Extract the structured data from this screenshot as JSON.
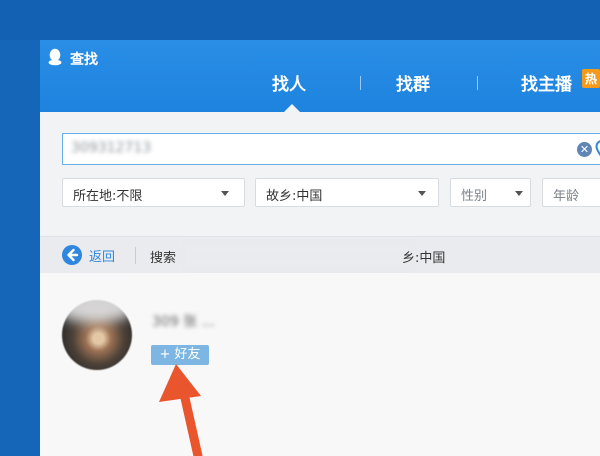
{
  "window": {
    "title": "查找"
  },
  "tabs": [
    {
      "label": "找人",
      "active": true
    },
    {
      "label": "找群",
      "active": false
    },
    {
      "label": "找主播",
      "active": false,
      "badge": "热"
    }
  ],
  "search": {
    "value": "309312713"
  },
  "filters": {
    "location": "所在地:不限",
    "hometown": "故乡:中国",
    "gender": "性别",
    "age": "年龄"
  },
  "toolbar": {
    "back_label": "返回",
    "criteria_prefix": "搜索",
    "criteria_suffix": "乡:中国"
  },
  "result": {
    "name": "309 张 ...",
    "add_friend_label": "+ 好友"
  },
  "colors": {
    "titlebar": "#1d83de",
    "accent": "#2f86de",
    "annotation_arrow": "#e9562e",
    "hot_badge": "#f39a1b"
  }
}
